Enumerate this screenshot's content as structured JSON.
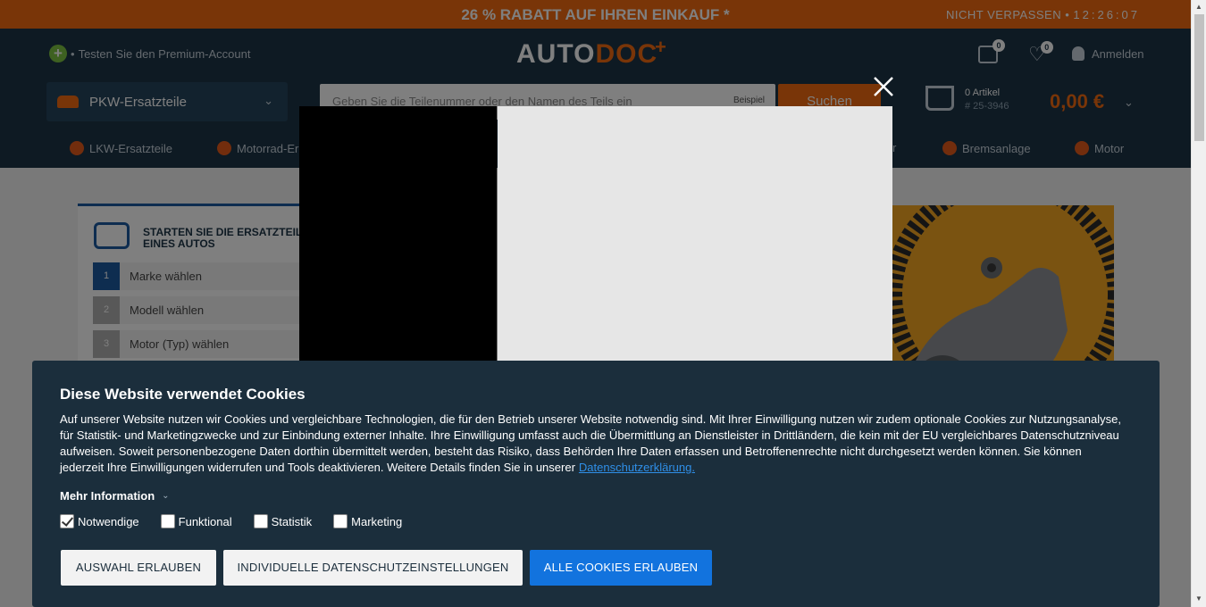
{
  "promo": {
    "text": "26 % RABATT AUF IHREN EINKAUF *",
    "timer_label": "NICHT VERPASSEN",
    "timer_value": "12:26:07"
  },
  "header": {
    "premium_text": "Testen Sie den Premium-Account",
    "logo_part1": "AUTO",
    "logo_part2": "DOC",
    "garage_count": "0",
    "wishlist_count": "0",
    "login_label": "Anmelden",
    "category_select": "PKW-Ersatzteile",
    "search_placeholder": "Geben Sie die Teilenummer oder den Namen des Teils ein",
    "search_hint": "Beispiel",
    "search_button": "Suchen",
    "cart_items": "0 Artikel",
    "cart_order_number": "# 25-3946",
    "cart_total": "0,00 €"
  },
  "nav": {
    "items": [
      {
        "label": "LKW-Ersatzteile",
        "icon": "truck-icon"
      },
      {
        "label": "Motorrad-Er",
        "icon": "motorcycle-icon"
      },
      {
        "label": "r",
        "icon": ""
      },
      {
        "label": "Bremsanlage",
        "icon": "brake-icon"
      },
      {
        "label": "Motor",
        "icon": "engine-icon"
      }
    ]
  },
  "selector": {
    "title": "STARTEN SIE DIE ERSATZTEIL AUSWAHL EINES AUTOS",
    "steps": [
      {
        "num": "1",
        "label": "Marke wählen"
      },
      {
        "num": "2",
        "label": "Modell wählen"
      },
      {
        "num": "3",
        "label": "Motor (Typ) wählen"
      }
    ]
  },
  "cookie": {
    "title": "Diese Website verwendet Cookies",
    "text": "Auf unserer Website nutzen wir Cookies und vergleichbare Technologien, die für den Betrieb unserer Website notwendig sind. Mit Ihrer Einwilligung nutzen wir zudem optionale Cookies zur Nutzungsanalyse, für Statistik- und Marketingzwecke und zur Einbindung externer Inhalte. Ihre Einwilligung umfasst auch die Übermittlung an Dienstleister in Drittländern, die kein mit der EU vergleichbares Datenschutzniveau aufweisen. Soweit personenbezogene Daten dorthin übermittelt werden, besteht das Risiko, dass Behörden Ihre Daten erfassen und Betroffenenrechte nicht durchgesetzt werden können. Sie können jederzeit Ihre Einwilligungen widerrufen und Tools deaktivieren. Weitere Details finden Sie in unserer",
    "link": "Datenschutzerklärung.",
    "more_info": "Mehr Information",
    "checkboxes": [
      {
        "label": "Notwendige",
        "checked": true
      },
      {
        "label": "Funktional",
        "checked": false
      },
      {
        "label": "Statistik",
        "checked": false
      },
      {
        "label": "Marketing",
        "checked": false
      }
    ],
    "buttons": {
      "allow_selection": "AUSWAHL ERLAUBEN",
      "individual": "INDIVIDUELLE DATENSCHUTZEINSTELLUNGEN",
      "allow_all": "ALLE COOKIES ERLAUBEN"
    }
  },
  "colors": {
    "brand_orange": "#f26a10",
    "header_navy": "#1c3447",
    "cookie_bg": "#1b2e3c",
    "primary_blue": "#1273de"
  }
}
